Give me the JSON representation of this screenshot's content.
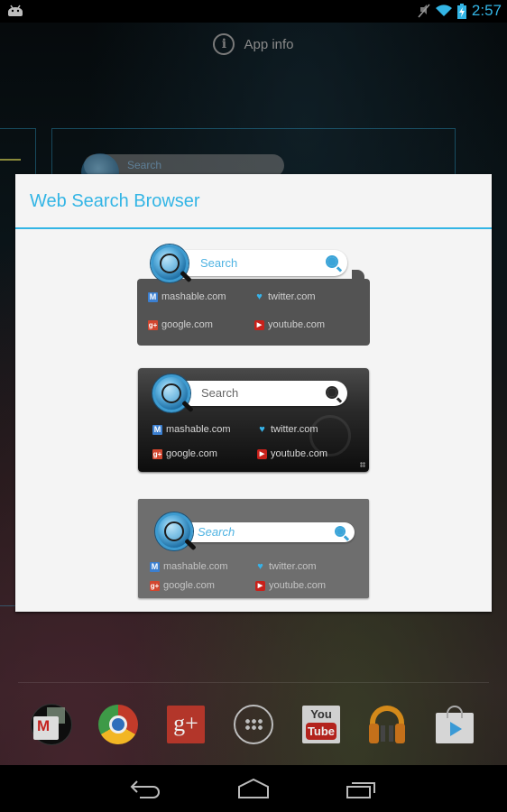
{
  "status_bar": {
    "time": "2:57",
    "icons": [
      "android-debug-icon",
      "mute-icon",
      "wifi-icon",
      "battery-charging-icon"
    ]
  },
  "app_info": {
    "label": "App info",
    "icon": "info-icon"
  },
  "background_widget": {
    "search_placeholder": "Search"
  },
  "dialog": {
    "title": "Web Search Browser",
    "accent_color": "#33b5e5",
    "options": [
      {
        "style": "dark-gray bubble",
        "search_placeholder": "Search",
        "links": [
          {
            "label": "mashable.com",
            "icon": "mashable-icon"
          },
          {
            "label": "twitter.com",
            "icon": "twitter-icon"
          },
          {
            "label": "google.com",
            "icon": "google-plus-icon"
          },
          {
            "label": "youtube.com",
            "icon": "youtube-icon"
          }
        ]
      },
      {
        "style": "black gradient",
        "search_placeholder": "Search",
        "links": [
          {
            "label": "mashable.com",
            "icon": "mashable-icon"
          },
          {
            "label": "twitter.com",
            "icon": "twitter-icon"
          },
          {
            "label": "google.com",
            "icon": "google-plus-icon"
          },
          {
            "label": "youtube.com",
            "icon": "youtube-icon"
          }
        ]
      },
      {
        "style": "light gray",
        "search_placeholder": "Search",
        "links": [
          {
            "label": "mashable.com",
            "icon": "mashable-icon"
          },
          {
            "label": "twitter.com",
            "icon": "twitter-icon"
          },
          {
            "label": "google.com",
            "icon": "google-plus-icon"
          },
          {
            "label": "youtube.com",
            "icon": "youtube-icon"
          }
        ]
      }
    ]
  },
  "dock": {
    "apps": [
      {
        "name": "Google folder",
        "icon": "gmail-folder-icon"
      },
      {
        "name": "Chrome",
        "icon": "chrome-icon"
      },
      {
        "name": "Google+",
        "icon": "google-plus-app-icon",
        "glyph": "g+"
      },
      {
        "name": "All apps",
        "icon": "app-drawer-icon"
      },
      {
        "name": "YouTube",
        "icon": "youtube-app-icon",
        "glyph_top": "You",
        "glyph_bottom": "Tube"
      },
      {
        "name": "Play Music",
        "icon": "play-music-icon"
      },
      {
        "name": "Play Store",
        "icon": "play-store-icon"
      }
    ]
  },
  "nav_bar": {
    "buttons": [
      "back",
      "home",
      "recents"
    ]
  }
}
